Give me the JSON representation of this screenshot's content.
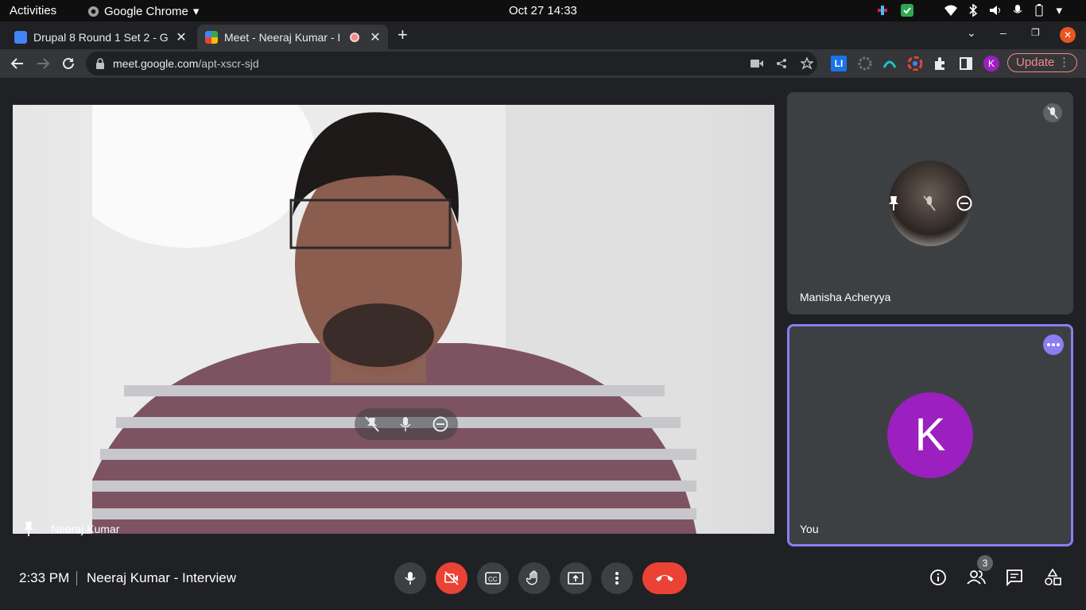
{
  "system": {
    "activities": "Activities",
    "app_name": "Google Chrome",
    "clock": "Oct 27  14:33"
  },
  "tabs": [
    {
      "title": "Drupal 8 Round 1 Set 2 - G",
      "close": "✕"
    },
    {
      "title": "Meet - Neeraj Kumar - I",
      "close": "✕"
    }
  ],
  "new_tab": "+",
  "window": {
    "down": "⌄",
    "min": "–",
    "max": "❐",
    "close": "✕"
  },
  "address": {
    "host": "meet.google.com",
    "path": "/apt-xscr-sjd"
  },
  "extensions": {
    "li": "LI",
    "profile_initial": "K",
    "update_label": "Update"
  },
  "meet": {
    "main_speaker": "Neeraj Kumar",
    "participants": [
      {
        "name": "Manisha Acheryya"
      },
      {
        "name": "You",
        "initial": "K"
      }
    ],
    "time": "2:33 PM",
    "title": "Neeraj Kumar - Interview",
    "people_count": "3"
  },
  "colors": {
    "leave": "#ea4335",
    "accent": "#8c7df2",
    "avatar": "#9c1fbf"
  }
}
